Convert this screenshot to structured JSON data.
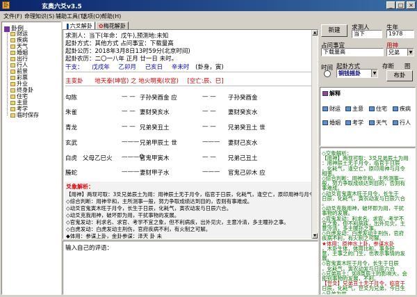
{
  "window": {
    "title": "玄奥六爻v3.5",
    "minimize": "_",
    "maximize": "□",
    "close": "×"
  },
  "menu": [
    "文件(F)",
    "命理知识(S)",
    "辅助工具(T)",
    "选项(O)",
    "帮助(H)"
  ],
  "tree": {
    "root": "卦例",
    "items": [
      "财运",
      "疾病",
      "天气",
      "婚姻",
      "出行",
      "行人",
      "前景",
      "彩票",
      "升业",
      "终身卦",
      "住宅",
      "主意",
      "考学",
      "临时保存"
    ]
  },
  "tabs": [
    "六爻解卦",
    "梅花解卦"
  ],
  "reading": {
    "line1": "求测人：当下(年命：戊午),预测地:未知",
    "line2": "起卦方式：其他方式    占问事宜：下载量高",
    "line3": "起卦公历：2018年3月8日13时59分(北京时间)",
    "line4": "起卦农历：二〇一八年 正月 廿一日 未时。",
    "ganzhi_prefix": "干支：",
    "ganzhi": [
      "戊戌年",
      "乙卯月",
      "己亥日",
      "辛未时"
    ],
    "xunkong": "(卦身，寅)",
    "gua_main": "主变卦",
    "gua_title": "地天泰(坤宫)  之  地火明夷(坎宫)",
    "gua_kong": "[空亡:辰、巳]",
    "rows": [
      {
        "shen": "勾陈",
        "fu": "",
        "left": "— —",
        "main": "子孙癸酉金 应",
        "right": "— —",
        "change": "子孙癸酉金"
      },
      {
        "shen": "朱雀",
        "fu": "",
        "left": "— —",
        "main": "妻财癸亥水",
        "right": "— —",
        "change": "妻财癸亥水"
      },
      {
        "shen": "青龙",
        "fu": "",
        "left": "— —",
        "main": "兄弟癸丑土",
        "right": "— —",
        "change": "兄弟癸丑土 世"
      },
      {
        "shen": "玄武",
        "fu": "",
        "left": "———",
        "main": "兄弟甲辰土 世",
        "right": "———",
        "change": "妻财己亥水"
      },
      {
        "shen": "白虎",
        "fu": "父母乙巳火",
        "left": "———O",
        "main": "官鬼甲寅木",
        "right": "— —",
        "change": "兄弟己丑土"
      },
      {
        "shen": "螣蛇",
        "fu": "",
        "left": "———",
        "main": "妻财甲子水",
        "right": "———",
        "change": "官鬼己卯木 应"
      }
    ],
    "analysis_title": "爻象解析：",
    "analysis_lines": [
      "【用神】两现可取：3爻兄弟辰土为用：用神辰土无于月令，临官于日辰，化耗气，逢空亡，原印用神与月令相害。",
      "◇综合判断：用神辛和，主所测事一般，努力争取成绩达到目的，否则有事难成。",
      "◇动爻官鬼寅木旺于月令，长生于日辰，化耗气，寅农动发与日辰六合。",
      "◇动爻克我用神，破坏即为用，干扰事物的发展。",
      "◇官鬼发动：利求名、求官、考学不宜之象，但不利病疾，出外见灾，主意冷清，多主瞳孙之事。",
      "◇白虎发动：白虎发动主刑伤，官府疾病不利，有火制之可解。",
      "◆体用：参谋上卦，金卦参谋：泽天 卦 未"
    ]
  },
  "comment_label": "输入自己的评语：",
  "right": {
    "new_button": "新建",
    "asker_label": "求测人",
    "asker_value": "当下",
    "birth_label": "生年",
    "birth_value": "1978",
    "question_label": "占问事宜",
    "question_value": "下载量高",
    "yongshen_label": "用神",
    "yongshen_value": "兄弟",
    "time_label": "时间",
    "method_label": "起卦方式",
    "method_value": "铜钱摇卦",
    "save_label": "存断",
    "pic_label": "图",
    "publish_button": "布卦",
    "jieyi": "解释",
    "categories": [
      "财运",
      "主意",
      "住宅",
      "疾病",
      "婚姻",
      "考学",
      "天气",
      "行人"
    ],
    "analysis_lines": [
      {
        "text": "◇交象解析：",
        "red": false
      },
      {
        "text": "【用神】两现可取：3爻兄弟辰土为用",
        "red": false
      },
      {
        "text": "：用神辰土无于月令，临官于日辰",
        "red": false
      },
      {
        "text": "，化耗气，逢空亡，原印用神与月令",
        "red": false
      },
      {
        "text": "相害。",
        "red": false
      },
      {
        "text": "◇综合判断：用神辛和，主所测事一",
        "red": false
      },
      {
        "text": "般，努力争取成绩达到目的，否则有",
        "red": false
      },
      {
        "text": "事难成。",
        "red": false
      },
      {
        "text": "◇动爻官鬼寅木旺于月令，长生于",
        "red": false
      },
      {
        "text": "日辰，化耗气，寅农动发与日辰六合",
        "red": false
      },
      {
        "text": "。",
        "red": false
      },
      {
        "text": "◇动爻克我用神，破坏即为用，干扰",
        "red": false
      },
      {
        "text": "事物的发展。",
        "red": false
      },
      {
        "text": "◇官鬼发动：利求名、求官、考学不",
        "red": false
      },
      {
        "text": "宜之象，但不利病疾，出外见灾，主",
        "red": false
      },
      {
        "text": "意冷清，多主瞳孙之事。",
        "red": false
      },
      {
        "text": "◇白虎发动：白虎发动主刑伤，官府",
        "red": false
      },
      {
        "text": "疾病不利，有火制之可解。",
        "red": false
      },
      {
        "text": "★体用：原神水上卦，参谋水卦",
        "red": true
      },
      {
        "text": "，木卦生体，体用比和，事多好",
        "red": false
      },
      {
        "text": "意，主事之的门生，也表示事情的发",
        "red": false
      },
      {
        "text": "展。",
        "red": false
      },
      {
        "text": "◇官鬼寅木旺于月令，长生于日辰",
        "red": false
      },
      {
        "text": "，化耗气，寅农动发与日辰六合",
        "red": false
      },
      {
        "text": "◇兄弟辰土：如8周辰土的影响大，会",
        "red": false
      },
      {
        "text": "拒别事物的发展，不利。",
        "red": false
      },
      {
        "text": "【世爻】兄弟丑土无于月令，临官于",
        "red": true
      },
      {
        "text": "日辰，化耗气，世爻为兄弟，今日生",
        "red": false
      },
      {
        "text": "◇兄弟为世，",
        "red": false
      }
    ]
  }
}
